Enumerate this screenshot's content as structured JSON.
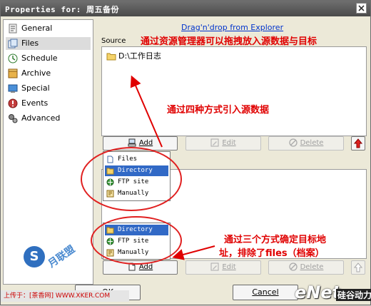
{
  "window": {
    "title": "Properties for: 周五备份"
  },
  "sidebar": {
    "items": [
      {
        "label": "General",
        "icon": "general-icon",
        "selected": false
      },
      {
        "label": "Files",
        "icon": "files-icon",
        "selected": true
      },
      {
        "label": "Schedule",
        "icon": "schedule-icon",
        "selected": false
      },
      {
        "label": "Archive",
        "icon": "archive-icon",
        "selected": false
      },
      {
        "label": "Special",
        "icon": "special-icon",
        "selected": false
      },
      {
        "label": "Events",
        "icon": "events-icon",
        "selected": false
      },
      {
        "label": "Advanced",
        "icon": "advanced-icon",
        "selected": false
      }
    ]
  },
  "main": {
    "drag_title": "Drag'n'drop from Explorer",
    "source_label": "Source",
    "source_items": [
      "D:\\工作日志"
    ],
    "source_buttons": {
      "add": "Add",
      "edit": "Edit",
      "delete": "Delete"
    },
    "dest_buttons": {
      "add": "Add",
      "edit": "Edit",
      "delete": "Delete"
    }
  },
  "source_menu": {
    "items": [
      {
        "label": "Files",
        "selected": false
      },
      {
        "label": "Directory",
        "selected": true
      },
      {
        "label": "FTP site",
        "selected": false
      },
      {
        "label": "Manually",
        "selected": false
      }
    ]
  },
  "dest_menu": {
    "items": [
      {
        "label": "Directory",
        "selected": true
      },
      {
        "label": "FTP site",
        "selected": false
      },
      {
        "label": "Manually",
        "selected": false
      }
    ]
  },
  "annotations": {
    "top": "通过资源管理器可以拖拽放入源数据与目标",
    "middle": "通过四种方式引入源数据",
    "bottom_line1": "通过三个方式确定目标地",
    "bottom_line2": "址，排除了files（档案）"
  },
  "footer": {
    "ok": "OK",
    "cancel": "Cancel"
  },
  "watermarks": {
    "upload": "上传于：[茶香网] WWW.XKER.COM",
    "site_logo": "S",
    "site_text": "月联盟",
    "enet": "eNet",
    "enet_sub": "硅谷动力"
  },
  "colors": {
    "annotation": "#e00000",
    "link": "#0033cc",
    "selection": "#3169c6"
  }
}
